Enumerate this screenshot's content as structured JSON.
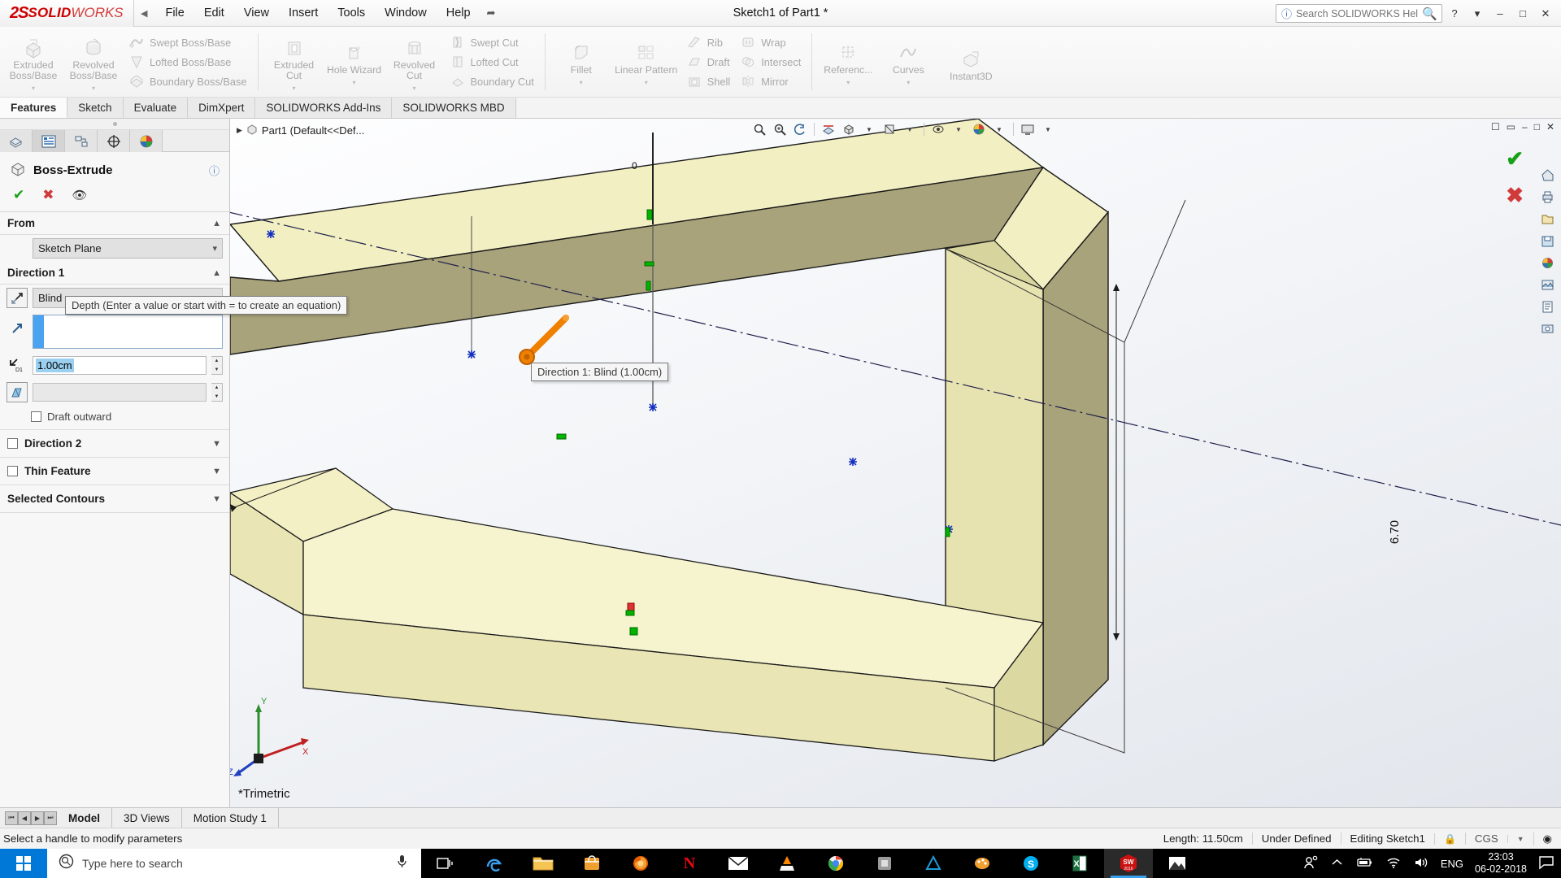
{
  "titlebar": {
    "logo_ds": "2S",
    "logo_bold": "SOLID",
    "logo_light": "WORKS",
    "collapse_icon": "chevron-left-icon",
    "pin_icon": "pin-icon",
    "document_title": "Sketch1 of Part1 *",
    "menu": [
      "File",
      "Edit",
      "View",
      "Insert",
      "Tools",
      "Window",
      "Help"
    ],
    "help_search_placeholder": "Search SOLIDWORKS Help",
    "help_search_value": "",
    "buttons": [
      "?",
      "chevron-down-icon",
      "minimize-icon",
      "maximize-icon",
      "close-icon"
    ]
  },
  "ribbon": {
    "groups": [
      {
        "big": [
          {
            "label_line1": "Extruded",
            "label_line2": "Boss/Base",
            "icon": "extruded-boss-icon"
          },
          {
            "label_line1": "Revolved",
            "label_line2": "Boss/Base",
            "icon": "revolved-boss-icon"
          }
        ],
        "small": [
          {
            "label": "Swept Boss/Base",
            "icon": "swept-boss-icon"
          },
          {
            "label": "Lofted Boss/Base",
            "icon": "lofted-boss-icon"
          },
          {
            "label": "Boundary Boss/Base",
            "icon": "boundary-boss-icon"
          }
        ]
      },
      {
        "big": [
          {
            "label_line1": "Extruded",
            "label_line2": "Cut",
            "icon": "extruded-cut-icon"
          },
          {
            "label_line1": "Hole Wizard",
            "label_line2": "",
            "icon": "hole-wizard-icon"
          },
          {
            "label_line1": "Revolved",
            "label_line2": "Cut",
            "icon": "revolved-cut-icon"
          }
        ],
        "small": [
          {
            "label": "Swept Cut",
            "icon": "swept-cut-icon"
          },
          {
            "label": "Lofted Cut",
            "icon": "lofted-cut-icon"
          },
          {
            "label": "Boundary Cut",
            "icon": "boundary-cut-icon"
          }
        ]
      },
      {
        "big": [
          {
            "label_line1": "Fillet",
            "label_line2": "",
            "icon": "fillet-icon"
          },
          {
            "label_line1": "Linear Pattern",
            "label_line2": "",
            "icon": "linear-pattern-icon"
          }
        ],
        "small": [
          {
            "label": "Rib",
            "icon": "rib-icon"
          },
          {
            "label": "Draft",
            "icon": "draft-icon"
          },
          {
            "label": "Shell",
            "icon": "shell-icon"
          }
        ],
        "small2": [
          {
            "label": "Wrap",
            "icon": "wrap-icon"
          },
          {
            "label": "Intersect",
            "icon": "intersect-icon"
          },
          {
            "label": "Mirror",
            "icon": "mirror-icon"
          }
        ]
      },
      {
        "big": [
          {
            "label_line1": "Referenc...",
            "label_line2": "",
            "icon": "reference-geometry-icon"
          },
          {
            "label_line1": "Curves",
            "label_line2": "",
            "icon": "curves-icon"
          },
          {
            "label_line1": "Instant3D",
            "label_line2": "",
            "icon": "instant3d-icon"
          }
        ],
        "small": []
      }
    ]
  },
  "command_tabs": {
    "items": [
      "Features",
      "Sketch",
      "Evaluate",
      "DimXpert",
      "SOLIDWORKS Add-Ins",
      "SOLIDWORKS MBD"
    ],
    "active": "Features"
  },
  "property_manager": {
    "tabs": [
      {
        "name": "feature-manager-tab",
        "icon": "feature-tree-icon",
        "active": false
      },
      {
        "name": "property-manager-tab",
        "icon": "property-list-icon",
        "active": true
      },
      {
        "name": "configuration-manager-tab",
        "icon": "configuration-icon",
        "active": false
      },
      {
        "name": "dimxpert-manager-tab",
        "icon": "dimxpert-icon",
        "active": false
      },
      {
        "name": "display-manager-tab",
        "icon": "appearance-sphere-icon",
        "active": false
      }
    ],
    "title": "Boss-Extrude",
    "title_icon": "extrude-feature-icon",
    "help_icon": "question-icon",
    "actions": [
      {
        "name": "accept-button",
        "glyph": "✔",
        "color": "#16a118"
      },
      {
        "name": "cancel-button",
        "glyph": "✖",
        "color": "#d13a3a"
      },
      {
        "name": "detailed-preview-button",
        "glyph": "◉",
        "color": "#3a3a3a"
      }
    ],
    "sections": {
      "from": {
        "header": "From",
        "start_condition": "Sketch Plane",
        "collapsed": false
      },
      "direction1": {
        "header": "Direction 1",
        "reverse_icon": "reverse-direction-icon",
        "end_condition": "Blind",
        "direction_icon": "direction-vector-icon",
        "direction_value": "",
        "depth_icon": "depth-dimension-icon",
        "depth_value": "1.00cm",
        "draft_icon": "draft-angle-icon",
        "draft_value": "",
        "draft_outward_label": "Draft outward",
        "draft_outward_checked": false
      },
      "direction2": {
        "header": "Direction 2",
        "checked": false,
        "collapsed": true
      },
      "thin_feature": {
        "header": "Thin Feature",
        "checked": false,
        "collapsed": true
      },
      "selected_contours": {
        "header": "Selected Contours",
        "collapsed": true
      }
    }
  },
  "graphics": {
    "feature_tree_label": "Part1  (Default<<Def...",
    "feature_tree_icon": "part-icon",
    "view_toolbar": [
      "zoom-to-fit-icon",
      "zoom-to-area-icon",
      "previous-view-icon",
      "section-view-icon",
      "view-orientation-icon",
      "display-style-icon",
      "hide-show-icon",
      "edit-appearance-icon",
      "apply-scene-icon",
      "view-settings-icon"
    ],
    "window_buttons": [
      "restore-down-icon",
      "minimize-icon",
      "maximize-icon",
      "close-icon"
    ],
    "right_toolbar": [
      "home-icon",
      "print-icon",
      "open-icon",
      "save-icon",
      "appearance-icon",
      "scene-icon",
      "notes-icon",
      "screen-capture-icon"
    ],
    "depth_tooltip": "Depth (Enter a value or start with = to create an equation)",
    "handle_tooltip": "Direction 1: Blind (1.00cm)",
    "view_orientation_label": "*Trimetric",
    "dimension_label": "6.70",
    "triad_labels": {
      "x": "X",
      "y": "Y",
      "z": "Z"
    },
    "confirm_corner": {
      "ok": "✔",
      "cancel": "✖"
    }
  },
  "bottom_tabs": {
    "items": [
      "Model",
      "3D Views",
      "Motion Study 1"
    ],
    "active": "Model",
    "nav_buttons": [
      "first-icon",
      "previous-icon",
      "next-icon",
      "last-icon"
    ]
  },
  "status_bar": {
    "message": "Select a handle to modify parameters",
    "length": "Length: 11.50cm",
    "state": "Under Defined",
    "editing": "Editing Sketch1",
    "lock_icon": "lock-icon",
    "units": "CGS",
    "units_chevron": "chevron-down-icon",
    "overlay_icon": "overlay-icon"
  },
  "taskbar": {
    "start_icon": "windows-start-icon",
    "search_placeholder": "Type here to search",
    "mic_icon": "microphone-icon",
    "apps": [
      {
        "name": "task-view-icon",
        "glyph": "⧉",
        "color": "#ffffff"
      },
      {
        "name": "edge-icon",
        "glyph": "e",
        "color": "#3aa0ee"
      },
      {
        "name": "file-explorer-icon",
        "glyph": "🗀",
        "color": "#f6bе4f"
      },
      {
        "name": "microsoft-store-icon",
        "glyph": "▣",
        "color": "#f0a030"
      },
      {
        "name": "firefox-icon",
        "glyph": "◉",
        "color": "#e66000"
      },
      {
        "name": "netflix-icon",
        "glyph": "N",
        "color": "#e50914"
      },
      {
        "name": "mail-icon",
        "glyph": "✉",
        "color": "#ffffff"
      },
      {
        "name": "vlc-icon",
        "glyph": "▲",
        "color": "#ff8800"
      },
      {
        "name": "chrome-icon",
        "glyph": "◉",
        "color": "#4285f4"
      },
      {
        "name": "app-icon",
        "glyph": "■",
        "color": "#8a8a8a"
      },
      {
        "name": "autodesk-icon",
        "glyph": "▲",
        "color": "#1e9ad6"
      },
      {
        "name": "paint-icon",
        "glyph": "●",
        "color": "#f0a030"
      },
      {
        "name": "skype-icon",
        "glyph": "S",
        "color": "#00aff0"
      },
      {
        "name": "excel-icon",
        "glyph": "X",
        "color": "#1d6f42"
      },
      {
        "name": "solidworks-taskbar-icon",
        "glyph": "SW",
        "color": "#cc0000"
      },
      {
        "name": "photos-icon",
        "glyph": "⛰",
        "color": "#ffffff"
      }
    ],
    "tray": {
      "people_icon": "people-icon",
      "chevron_icon": "chevron-up-icon",
      "battery_icon": "battery-icon",
      "wifi_icon": "wifi-icon",
      "volume_icon": "volume-icon",
      "language": "ENG",
      "time": "23:03",
      "date": "06-02-2018",
      "notification_icon": "notification-icon"
    }
  }
}
